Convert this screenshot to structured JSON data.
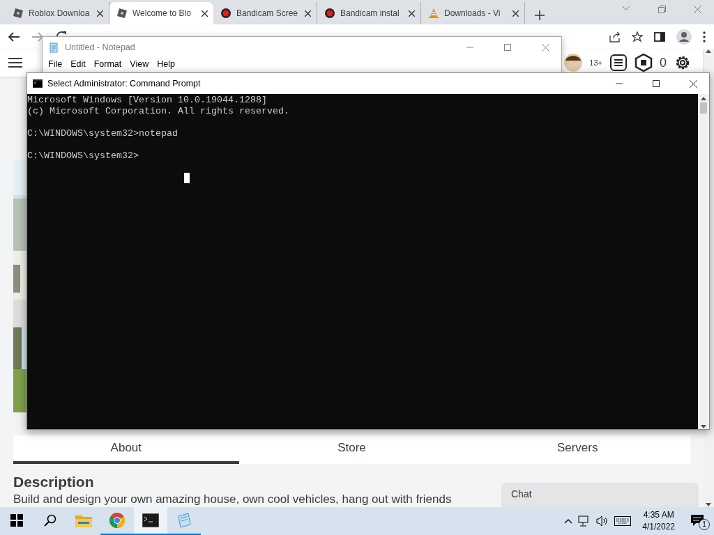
{
  "browser": {
    "tabs": [
      {
        "title": "Roblox Downloa",
        "kind": "roblox",
        "selected": false
      },
      {
        "title": "Welcome to Blo",
        "kind": "roblox",
        "selected": true
      },
      {
        "title": "Bandicam Scree",
        "kind": "record",
        "selected": false
      },
      {
        "title": "Bandicam instal",
        "kind": "record",
        "selected": false
      },
      {
        "title": "Downloads - Vi",
        "kind": "cone",
        "selected": false
      }
    ],
    "page": {
      "age": "13+",
      "robux": "0",
      "tabs": [
        {
          "label": "About",
          "selected": true
        },
        {
          "label": "Store",
          "selected": false
        },
        {
          "label": "Servers",
          "selected": false
        }
      ],
      "heading": "Description",
      "description": "Build and design your own amazing house, own cool vehicles, hang out with friends",
      "chat": "Chat"
    }
  },
  "notepad": {
    "title": "Untitled - Notepad",
    "menu": [
      "File",
      "Edit",
      "Format",
      "View",
      "Help"
    ]
  },
  "cmd": {
    "title": "Select Administrator: Command Prompt",
    "blocks": [
      [
        "Microsoft Windows [Version 10.0.19044.1288]",
        "(c) Microsoft Corporation. All rights reserved."
      ],
      [
        "C:\\WINDOWS\\system32>notepad"
      ],
      [
        "C:\\WINDOWS\\system32>"
      ]
    ]
  },
  "taskbar": {
    "apps": [
      {
        "kind": "explorer",
        "running": false,
        "active": false
      },
      {
        "kind": "chrome",
        "running": true,
        "active": false
      },
      {
        "kind": "terminal",
        "running": true,
        "active": true
      },
      {
        "kind": "notepad",
        "running": true,
        "active": false
      }
    ],
    "time": "4:35 AM",
    "date": "4/1/2022",
    "notifications": "1"
  }
}
